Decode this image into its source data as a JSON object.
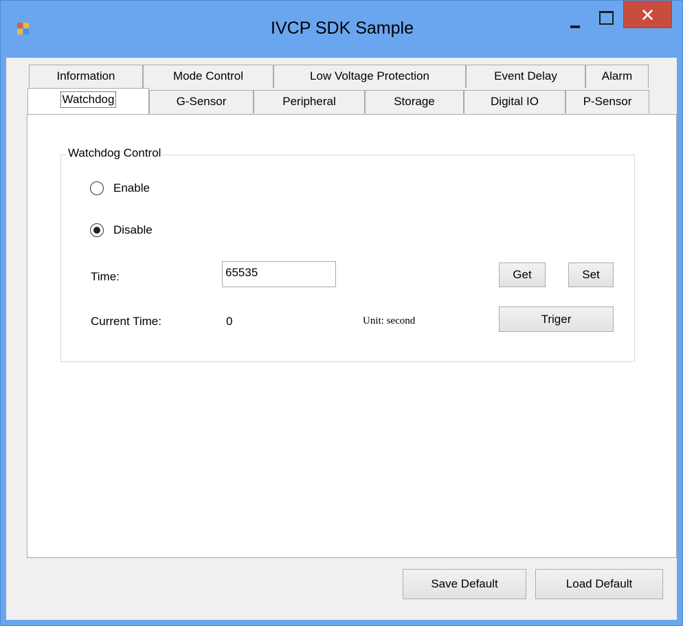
{
  "window": {
    "title": "IVCP SDK Sample",
    "close_glyph": "✕"
  },
  "tabs": {
    "row_top": [
      "Information",
      "Mode Control",
      "Low Voltage Protection",
      "Event Delay",
      "Alarm"
    ],
    "row_bottom": [
      "Watchdog",
      "G-Sensor",
      "Peripheral",
      "Storage",
      "Digital IO",
      "P-Sensor"
    ],
    "selected": "Watchdog"
  },
  "watchdog": {
    "group_title": "Watchdog Control",
    "enable_label": "Enable",
    "disable_label": "Disable",
    "selected_mode": "Disable",
    "time_label": "Time:",
    "time_value": "65535",
    "get_label": "Get",
    "set_label": "Set",
    "current_time_label": "Current Time:",
    "current_time_value": "0",
    "unit_label": "Unit: second",
    "trigger_label": "Triger"
  },
  "footer": {
    "save_default_label": "Save Default",
    "load_default_label": "Load Default"
  },
  "colors": {
    "titlebar": "#6aa6f0",
    "close_button": "#c94d3e",
    "client_background": "#f0f0f0"
  },
  "icons": {
    "app": "app-icon",
    "minimize": "minimize-icon",
    "maximize": "maximize-icon",
    "close": "close-icon"
  }
}
